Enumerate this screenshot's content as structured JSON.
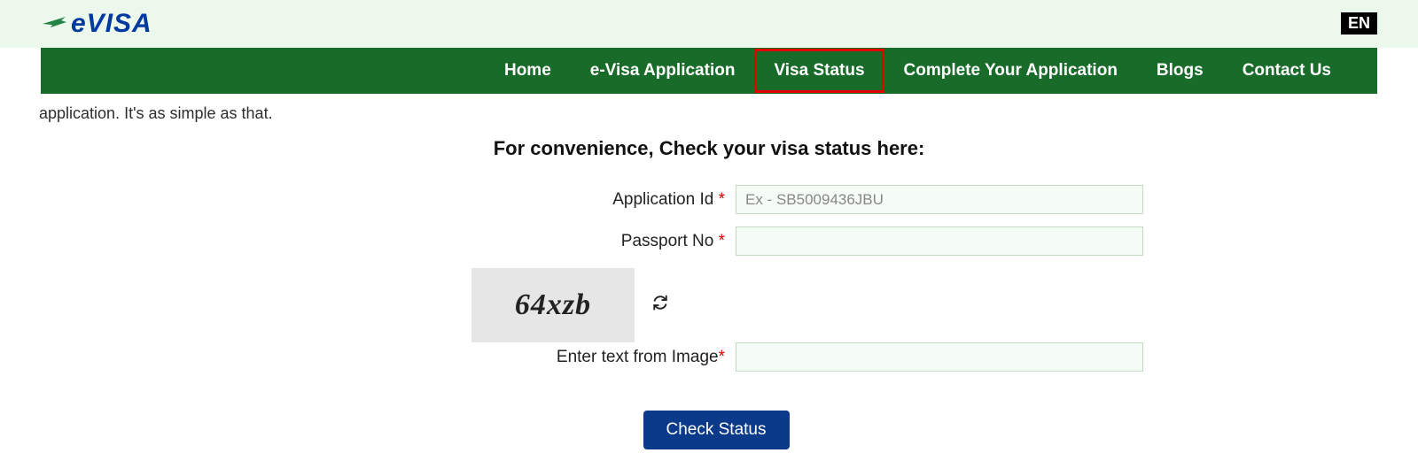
{
  "header": {
    "logo_text": "eVISA",
    "lang": "EN"
  },
  "nav": {
    "items": [
      {
        "label": "Home",
        "active": false
      },
      {
        "label": "e-Visa Application",
        "active": false
      },
      {
        "label": "Visa Status",
        "active": true
      },
      {
        "label": "Complete Your Application",
        "active": false
      },
      {
        "label": "Blogs",
        "active": false
      },
      {
        "label": "Contact Us",
        "active": false
      }
    ]
  },
  "cutoff_text": "application. It's as simple as that.",
  "form": {
    "title": "For convenience, Check your visa status here:",
    "app_id_label": "Application Id",
    "app_id_placeholder": "Ex - SB5009436JBU",
    "passport_label": "Passport No",
    "captcha_text": "64xzb",
    "captcha_label": "Enter text from Image",
    "submit_label": "Check Status",
    "required_mark": "*"
  }
}
